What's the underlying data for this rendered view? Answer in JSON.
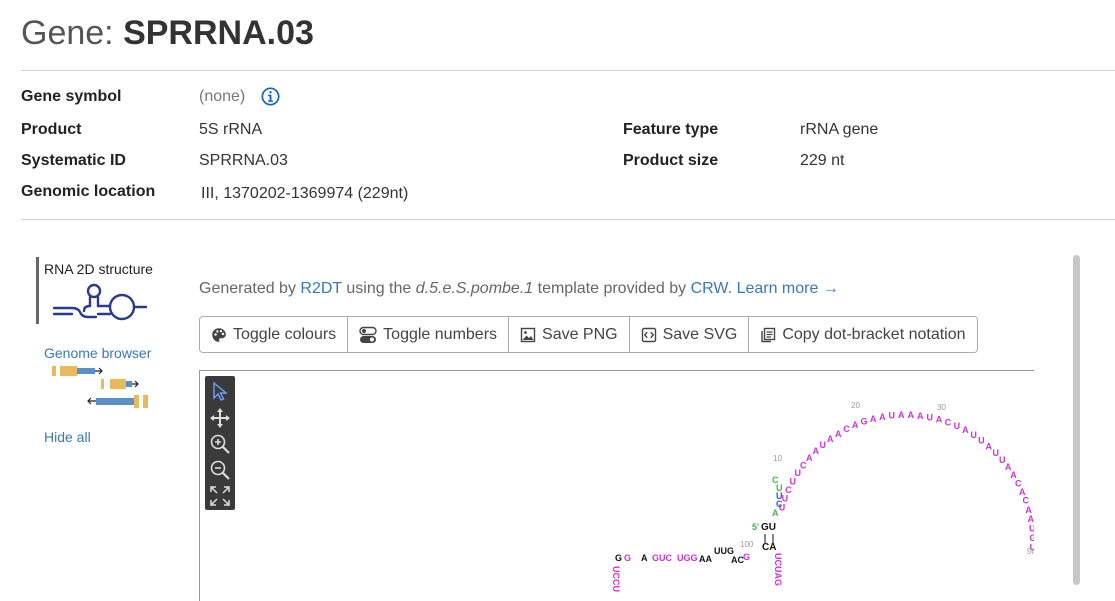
{
  "header": {
    "title_prefix": "Gene:",
    "title_name": "SPRRNA.03"
  },
  "details": {
    "gene_symbol_label": "Gene symbol",
    "gene_symbol_value": "(none)",
    "product_label": "Product",
    "product_value": "5S rRNA",
    "systematic_id_label": "Systematic ID",
    "systematic_id_value": "SPRRNA.03",
    "genomic_location_label": "Genomic location",
    "genomic_location_value": "III, 1370202-1369974 (229nt)",
    "feature_type_label": "Feature type",
    "feature_type_value": "rRNA gene",
    "product_size_label": "Product size",
    "product_size_value": "229 nt"
  },
  "sidebar": {
    "rna_title": "RNA 2D structure",
    "genome_browser": "Genome browser",
    "hide_all": "Hide all"
  },
  "structure": {
    "generated_by": "Generated by",
    "r2dt": "R2DT",
    "using_the": "using the",
    "template_name": "d.5.e.S.pombe.1",
    "template_provided_by": "template provided by",
    "crw": "CRW",
    "period": ".",
    "learn_more": "Learn more →"
  },
  "buttons": {
    "toggle_colours": "Toggle colours",
    "toggle_numbers": "Toggle numbers",
    "save_png": "Save PNG",
    "save_svg": "Save SVG",
    "copy_dot_bracket": "Copy dot-bracket notation"
  },
  "diagram": {
    "num_10": "10",
    "num_20": "20",
    "num_30": "30",
    "num_50": "50",
    "num_100": "100",
    "five_prime": "5'",
    "loop_seq": "UUCUUCAAUAACAGAAUAAAUACUAUUAUUAACACAAUGU",
    "stem_seq": "CAAAG",
    "stem_right": "UCUAG",
    "gu_pair": "GU",
    "ca_pair": "CA",
    "base_u": "U",
    "base_c": "C",
    "base_u2": "U",
    "base_a": "A",
    "base_c2": "C",
    "left_b1": "G",
    "left_b2": "G",
    "left_b3": "A",
    "left_b4": "GUC",
    "left_b5": "UGG",
    "left_b6": "AA",
    "left_b7": "UUG",
    "left_b8": "AC",
    "left_b9": "G",
    "left_col": "UCCU",
    "colors": {
      "magenta": "#d030d8",
      "green": "#3dbb3d",
      "blue": "#2060d0",
      "black": "#111111",
      "grey": "#999999"
    }
  },
  "theme": {
    "link": "#3a78b5",
    "title": "#555555",
    "icon_blue": "#1565c0",
    "gene_orange": "#f0c060",
    "gene_blue": "#5b8fc7"
  }
}
